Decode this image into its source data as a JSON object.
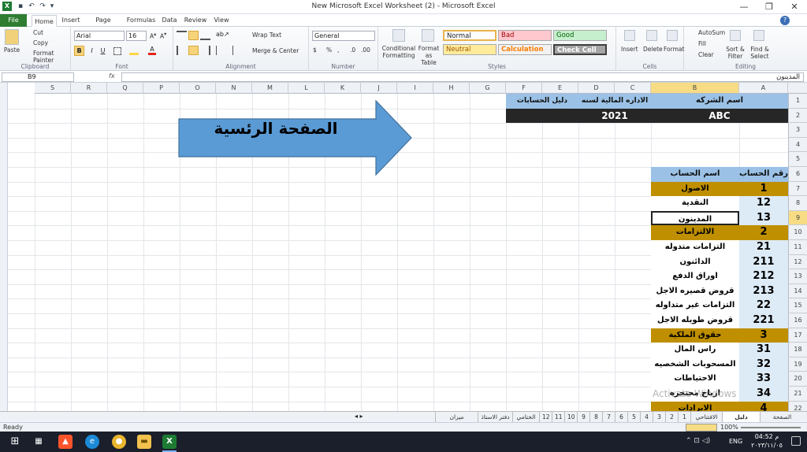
{
  "window": {
    "title": "New Microsoft Excel Worksheet (2)  -  Microsoft Excel",
    "minimize": "—",
    "restore": "❐",
    "close": "✕"
  },
  "tabs": [
    "File",
    "Home",
    "Insert",
    "Page Layout",
    "Formulas",
    "Data",
    "Review",
    "View"
  ],
  "ribbon": {
    "clipboard": {
      "paste": "Paste",
      "cut": "Cut",
      "copy": "Copy",
      "format_painter": "Format Painter",
      "label": "Clipboard"
    },
    "font": {
      "name": "Arial",
      "size": "16",
      "label": "Font",
      "bold": "B",
      "italic": "I",
      "underline": "U"
    },
    "alignment": {
      "wrap": "Wrap Text",
      "merge": "Merge & Center",
      "label": "Alignment"
    },
    "number": {
      "format": "General",
      "currency": "$",
      "percent": "%",
      "comma": ",",
      "label": "Number"
    },
    "styles": {
      "conditional": "Conditional Formatting",
      "format_table": "Format as Table",
      "normal": "Normal",
      "bad": "Bad",
      "good": "Good",
      "neutral": "Neutral",
      "calculation": "Calculation",
      "check_cell": "Check Cell",
      "label": "Styles"
    },
    "cells": {
      "insert": "Insert",
      "delete": "Delete",
      "format": "Format",
      "label": "Cells"
    },
    "editing": {
      "autosum": "AutoSum",
      "fill": "Fill",
      "clear": "Clear",
      "sort": "Sort & Filter",
      "find": "Find & Select",
      "label": "Editing"
    }
  },
  "formula_bar": {
    "name_box": "B9",
    "fx": "fx",
    "value": "المدينون"
  },
  "columns_rtl": [
    "A",
    "B",
    "C",
    "D",
    "E",
    "F",
    "G",
    "H",
    "I",
    "J",
    "K",
    "L",
    "M",
    "N",
    "O",
    "P",
    "Q",
    "R",
    "S"
  ],
  "rows": [
    "1",
    "2",
    "3",
    "4",
    "5",
    "6",
    "7",
    "8",
    "9",
    "10",
    "11",
    "12",
    "13",
    "14",
    "15",
    "16",
    "17",
    "18",
    "19",
    "20",
    "21",
    "22"
  ],
  "header_block": {
    "company_label": "اسم الشركه",
    "period_label": "الاداره المالية لسنه",
    "guide_label": "دليل الحسابات",
    "company_value": "ABC",
    "year_value": "2021"
  },
  "arrow_text": "الصفحة الرئسية",
  "accounts_header": {
    "number": "رقم الحساب",
    "name": "اسم الحساب"
  },
  "accounts": [
    {
      "num": "1",
      "name": "الاصول",
      "kind": "group"
    },
    {
      "num": "12",
      "name": "النقدية",
      "kind": "white"
    },
    {
      "num": "13",
      "name": "المدينون",
      "kind": "selected"
    },
    {
      "num": "2",
      "name": "الالتزامات",
      "kind": "group"
    },
    {
      "num": "21",
      "name": "التزامات متدوله",
      "kind": "white"
    },
    {
      "num": "211",
      "name": "الدائنون",
      "kind": "white"
    },
    {
      "num": "212",
      "name": "اوراق الدفع",
      "kind": "white"
    },
    {
      "num": "213",
      "name": "قروض قصيره الاجل",
      "kind": "white"
    },
    {
      "num": "22",
      "name": "التزامات غير متداوله",
      "kind": "white"
    },
    {
      "num": "221",
      "name": "قروض طويله الاجل",
      "kind": "white"
    },
    {
      "num": "3",
      "name": "حقوق الملكية",
      "kind": "group"
    },
    {
      "num": "31",
      "name": "راس المال",
      "kind": "white"
    },
    {
      "num": "32",
      "name": "المسحوبات الشخصيه",
      "kind": "white"
    },
    {
      "num": "33",
      "name": "الاحتياطات",
      "kind": "white"
    },
    {
      "num": "34",
      "name": "ارباح محتجزه",
      "kind": "white"
    },
    {
      "num": "4",
      "name": "الايرادات",
      "kind": "group"
    }
  ],
  "watermark": "Activate Windows",
  "sheet_tabs": [
    "الصفحة الرئسية",
    "دليل الحسابات",
    "الافتتاحي",
    "1",
    "2",
    "3",
    "4",
    "5",
    "6",
    "7",
    "8",
    "9",
    "10",
    "11",
    "12",
    "الختامي",
    "دفتر الاستاذ",
    "ميزان المراجعة"
  ],
  "status": {
    "ready": "Ready",
    "zoom": "100%"
  },
  "taskbar": {
    "time": "04:52 م",
    "date": "٢٠٢٣/١١/٠٥",
    "lang": "ENG"
  },
  "colors": {
    "header_blue": "#9bc2e6",
    "dark_row": "#262626",
    "group_gold": "#bf8f00",
    "light_blue": "#ddebf7",
    "arrow": "#5b9bd5",
    "selected_header": "#f7dc84"
  }
}
